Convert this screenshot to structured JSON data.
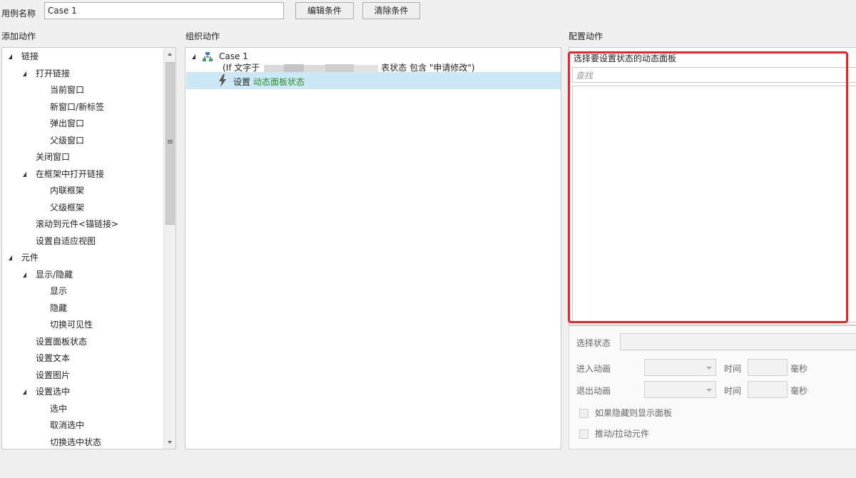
{
  "top": {
    "case_label": "用例名称",
    "case_value": "Case 1",
    "edit_condition": "编辑条件",
    "clear_condition": "清除条件"
  },
  "sections": {
    "add_action": "添加动作",
    "organize_action": "组织动作",
    "configure_action": "配置动作"
  },
  "tree": [
    {
      "label": "链接",
      "level": 0,
      "expanded": true
    },
    {
      "label": "打开链接",
      "level": 1,
      "expanded": true
    },
    {
      "label": "当前窗口",
      "level": 2
    },
    {
      "label": "新窗口/新标签",
      "level": 2
    },
    {
      "label": "弹出窗口",
      "level": 2
    },
    {
      "label": "父级窗口",
      "level": 2
    },
    {
      "label": "关闭窗口",
      "level": 1
    },
    {
      "label": "在框架中打开链接",
      "level": 1,
      "expanded": true
    },
    {
      "label": "内联框架",
      "level": 2
    },
    {
      "label": "父级框架",
      "level": 2
    },
    {
      "label": "滚动到元件<锚链接>",
      "level": 1
    },
    {
      "label": "设置自适应视图",
      "level": 1
    },
    {
      "label": "元件",
      "level": 0,
      "expanded": true
    },
    {
      "label": "显示/隐藏",
      "level": 1,
      "expanded": true
    },
    {
      "label": "显示",
      "level": 2
    },
    {
      "label": "隐藏",
      "level": 2
    },
    {
      "label": "切换可见性",
      "level": 2
    },
    {
      "label": "设置面板状态",
      "level": 1
    },
    {
      "label": "设置文本",
      "level": 1
    },
    {
      "label": "设置图片",
      "level": 1
    },
    {
      "label": "设置选中",
      "level": 1,
      "expanded": true
    },
    {
      "label": "选中",
      "level": 2
    },
    {
      "label": "取消选中",
      "level": 2
    },
    {
      "label": "切换选中状态",
      "level": 2
    }
  ],
  "organize": {
    "case_name": "Case 1",
    "condition_prefix": "(If 文字于",
    "condition_suffix": "表状态 包含 \"申请修改\")",
    "action_verb": "设置",
    "action_target": "动态面板状态"
  },
  "configure": {
    "select_panel_label": "选择要设置状态的动态面板",
    "search_placeholder": "查找",
    "select_state": "选择状态",
    "enter_animation": "进入动画",
    "exit_animation": "退出动画",
    "time_label": "时间",
    "ms_label": "毫秒",
    "show_if_hidden": "如果隐藏则显示面板",
    "push_pull": "推动/拉动元件"
  },
  "colors": {
    "highlight": "#e8252c",
    "selection": "#cce8f6",
    "action_target": "#2a8d2a"
  }
}
